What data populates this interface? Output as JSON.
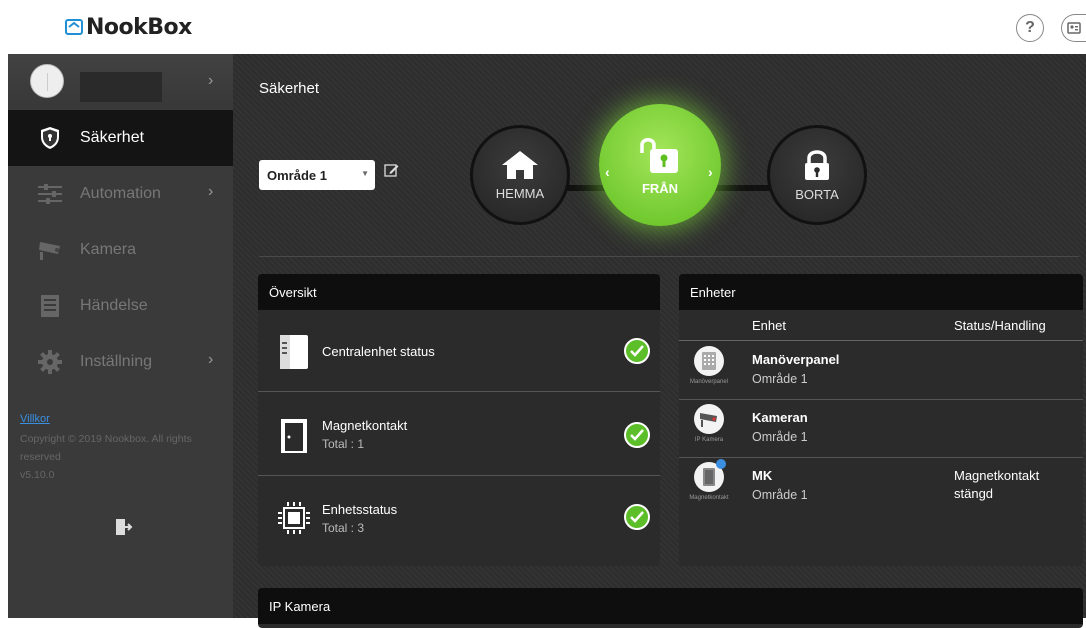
{
  "brand": {
    "name": "NookBox"
  },
  "header": {
    "help_icon": "question-circle-icon",
    "account_icon": "id-card-icon"
  },
  "sidebar": {
    "items": [
      {
        "label": "Säkerhet",
        "icon": "shield-icon",
        "active": true
      },
      {
        "label": "Automation",
        "icon": "sliders-icon",
        "has_submenu": true
      },
      {
        "label": "Kamera",
        "icon": "camera-icon"
      },
      {
        "label": "Händelse",
        "icon": "list-icon"
      },
      {
        "label": "Inställning",
        "icon": "gear-icon",
        "has_submenu": true
      }
    ],
    "footer": {
      "terms": "Villkor",
      "copyright": "Copyright © 2019 Nookbox. All rights reserved",
      "version": "v5.10.0"
    }
  },
  "security": {
    "title": "Säkerhet",
    "area": {
      "selected": "Område 1"
    },
    "modes": {
      "home": "HEMMA",
      "off": "FRÅN",
      "away": "BORTA",
      "active": "FRÅN"
    }
  },
  "overview": {
    "title": "Översikt",
    "rows": [
      {
        "title": "Centralenhet status",
        "sub": ""
      },
      {
        "title": "Magnetkontakt",
        "sub": "Total : 1"
      },
      {
        "title": "Enhetsstatus",
        "sub": "Total : 3"
      }
    ]
  },
  "devices": {
    "title": "Enheter",
    "col_device": "Enhet",
    "col_status": "Status/Handling",
    "rows": [
      {
        "name": "Manöverpanel",
        "area": "Område 1",
        "status": "",
        "caption": "Manöverpanel"
      },
      {
        "name": "Kameran",
        "area": "Område 1",
        "status": "",
        "caption": "IP Kamera"
      },
      {
        "name": "MK",
        "area": "Område 1",
        "status": "Magnetkontakt stängd",
        "caption": "Magnetkontakt"
      }
    ]
  },
  "ipcamera": {
    "title": "IP Kamera"
  },
  "colors": {
    "accent_green": "#5cbf2a",
    "link_blue": "#3b8fe0"
  }
}
